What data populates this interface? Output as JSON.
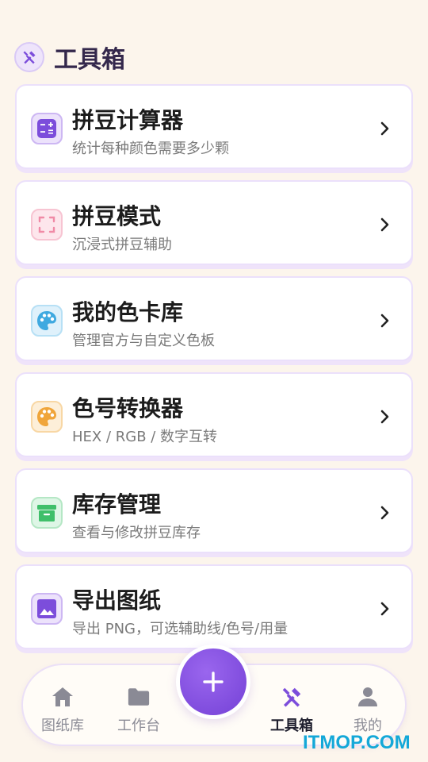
{
  "header": {
    "title": "工具箱",
    "icon": "tools-icon"
  },
  "tools": [
    {
      "title": "拼豆计算器",
      "subtitle": "统计每种颜色需要多少颗",
      "icon": "calculator-icon",
      "color": "#7c4ddb"
    },
    {
      "title": "拼豆模式",
      "subtitle": "沉浸式拼豆辅助",
      "icon": "fullscreen-icon",
      "color": "#f08aa6"
    },
    {
      "title": "我的色卡库",
      "subtitle": "管理官方与自定义色板",
      "icon": "palette-icon",
      "color": "#3fa9e0"
    },
    {
      "title": "色号转换器",
      "subtitle": "HEX / RGB / 数字互转",
      "icon": "palette-icon",
      "color": "#f0a53a"
    },
    {
      "title": "库存管理",
      "subtitle": "查看与修改拼豆库存",
      "icon": "archive-icon",
      "color": "#3fbf6a"
    },
    {
      "title": "导出图纸",
      "subtitle": "导出 PNG，可选辅助线/色号/用量",
      "icon": "image-icon",
      "color": "#7c4ddb"
    }
  ],
  "nav": {
    "items": [
      {
        "label": "图纸库",
        "icon": "home-icon"
      },
      {
        "label": "工作台",
        "icon": "folder-icon"
      },
      {
        "label": "工具箱",
        "icon": "tools-icon",
        "active": true
      },
      {
        "label": "我的",
        "icon": "user-icon"
      }
    ],
    "fab_icon": "plus-icon"
  },
  "watermark": "ITMOP.COM"
}
